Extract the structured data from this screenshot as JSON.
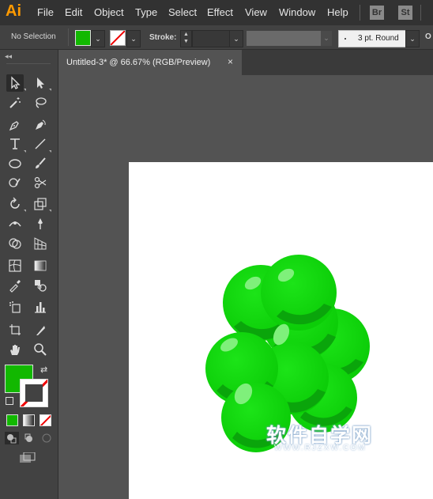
{
  "app": {
    "logo": "Ai"
  },
  "menu": [
    "File",
    "Edit",
    "Object",
    "Type",
    "Select",
    "Effect",
    "View",
    "Window",
    "Help"
  ],
  "app_buttons": [
    "Br",
    "St"
  ],
  "control_bar": {
    "selection_status": "No Selection",
    "fill_color": "#12b800",
    "stroke_label": "Stroke:",
    "stroke_weight": "",
    "brush": "3 pt. Round",
    "opacity_label_partial": "O"
  },
  "document": {
    "tab_title": "Untitled-3* @ 66.67% (RGB/Preview)",
    "close_glyph": "×"
  },
  "tools": {
    "fill_color": "#12b800",
    "stroke": "none",
    "selected_tool": "selection"
  },
  "artwork": {
    "base_color": "#0fd40b",
    "shadow_color": "#0aa50b",
    "highlight_color": "#7ff07b"
  },
  "watermark": {
    "main": "软件自学网",
    "sub": "WWW.RJZXW.COM"
  }
}
